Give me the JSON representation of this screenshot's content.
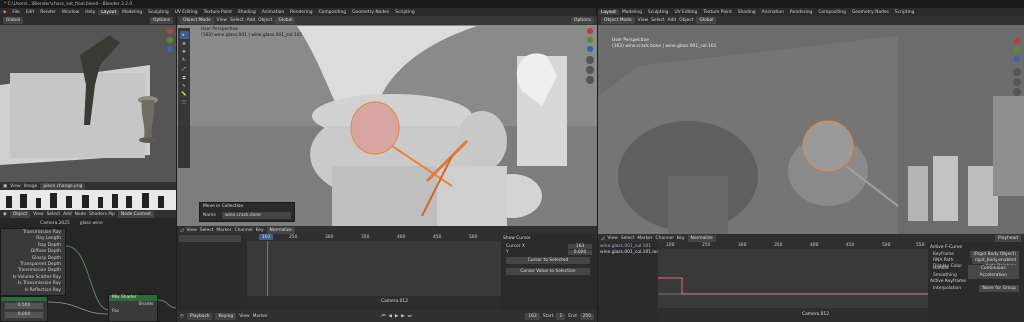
{
  "title": "* C:\\Users\\...\\Blender\\chess_set_final.blend - Blender 3.2.0",
  "menu": [
    "File",
    "Edit",
    "Render",
    "Window",
    "Help"
  ],
  "workspace_tabs_left": [
    "Layout",
    "Modeling",
    "Sculpting",
    "UV Editing",
    "Texture Paint",
    "Shading",
    "Animation",
    "Rendering",
    "Compositing",
    "Geometry Nodes",
    "Scripting"
  ],
  "workspace_tabs_right": [
    "Layout",
    "Modeling",
    "Sculpting",
    "UV Editing",
    "Texture Paint",
    "Shading",
    "Animation",
    "Rendering",
    "Compositing",
    "Geometry Nodes",
    "Scripting"
  ],
  "active_tab": "Layout",
  "viewport_small": {
    "mode": "Global",
    "options": "Options"
  },
  "viewport_main": {
    "mode": "Object Mode",
    "menus": [
      "View",
      "Select",
      "Add",
      "Object"
    ],
    "transform": "Global",
    "info1": "User Perspective",
    "info2": "(163) wine.glass.001 | wine.glass.001_col.101",
    "options": "Options"
  },
  "viewport_right": {
    "mode": "Object Mode",
    "menus": [
      "View",
      "Select",
      "Add",
      "Object"
    ],
    "transform": "Global",
    "info1": "User Perspective",
    "info2": "(163) wine.crack.bone | wine.glass.001_col.101",
    "options": "Options"
  },
  "image_editor": {
    "menus": [
      "View",
      "Image"
    ],
    "image_name": "piece change.png"
  },
  "node_editor": {
    "menus": [
      "Object",
      "View",
      "Select",
      "Add",
      "Node",
      "Shaders Pip",
      "Node Context"
    ],
    "object_name": "Camera.2025",
    "material": "glass wine",
    "outputs": [
      "Transmission Ray",
      "Ray Length",
      "Ray Depth",
      "Diffuse Depth",
      "Glossy Depth",
      "Transparent Depth",
      "Transmission Depth",
      "Is Volume Scatter Ray",
      "Is Transmission Ray",
      "Is Reflection Ray"
    ],
    "mix_shader": "Mix Shader",
    "mix_in": "Shader",
    "mix_fac": "Fac",
    "val_a": "0.500",
    "val_b": "0.000"
  },
  "move_panel": {
    "title": "Move in Collection",
    "label": "Name",
    "value": "wine.crack.done"
  },
  "graph_left": {
    "menus": [
      "View",
      "Select",
      "Marker",
      "Channel",
      "Key",
      "Normalize"
    ],
    "search": "",
    "ticks": [
      "250",
      "300",
      "350",
      "400",
      "450",
      "500",
      "550"
    ],
    "frame": "163",
    "camera_marker": "Camera.012",
    "side_title": "Show Cursor",
    "cursor_x_label": "Cursor X",
    "cursor_x": "163",
    "cursor_y_label": "Y",
    "cursor_y": "0.000",
    "side_btn1": "Cursor to Selected",
    "side_btn2": "Cursor Value to Selection"
  },
  "playback_bar": {
    "items": [
      "Playback",
      "Keying",
      "View",
      "Marker"
    ],
    "start_label": "Start",
    "start": "1",
    "end_label": "End",
    "end": "250",
    "frame": "163"
  },
  "graph_right": {
    "menus": [
      "View",
      "Select",
      "Marker",
      "Channel",
      "Key",
      "Normalize"
    ],
    "playhead": "Playhead",
    "channels": [
      "wine.glass.001_col.101",
      "wine.glass.001_col.101.location"
    ],
    "ticks": [
      "200",
      "250",
      "300",
      "350",
      "400",
      "450",
      "500",
      "550"
    ],
    "frame": "163",
    "camera_marker": "Camera.012"
  },
  "fcurve_panel": {
    "title": "Active F-Curve",
    "fields": [
      {
        "label": "Keyframe",
        "value": "(Rigid Body Object)"
      },
      {
        "label": "RNA Path",
        "value": "rigid_body.enabled"
      },
      {
        "label": "Display Color",
        "value": "Auto Rainbow"
      },
      {
        "label": "Handle Smoothing",
        "value": "Continuous Acceleration"
      }
    ],
    "section2": "Active Keyframe",
    "interp_label": "Interpolation",
    "interp": "None for Group"
  },
  "colors": {
    "accent": "#4a7cc7",
    "orange": "#e8853a",
    "header": "#303030",
    "panel": "#2b2b2b"
  }
}
